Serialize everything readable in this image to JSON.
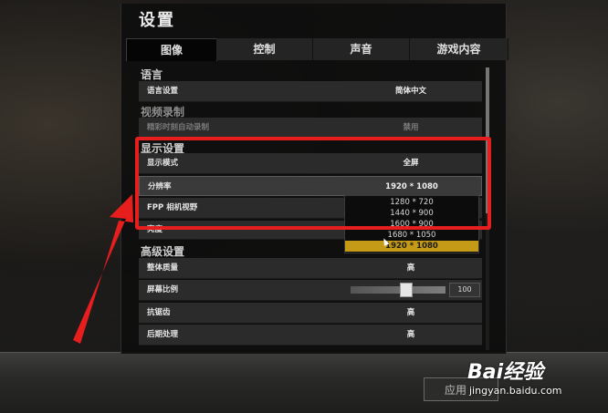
{
  "window": {
    "title": "设置"
  },
  "tabs": [
    {
      "label": "图像",
      "active": true
    },
    {
      "label": "控制",
      "active": false
    },
    {
      "label": "声音",
      "active": false
    },
    {
      "label": "游戏内容",
      "active": false
    }
  ],
  "sections": {
    "language": "语言",
    "video_recording": "视频录制",
    "display": "显示设置",
    "advanced": "高级设置"
  },
  "rows": {
    "language": {
      "label": "语言设置",
      "value": "简体中文"
    },
    "highlight": {
      "label": "精彩时刻自动录制",
      "value": "禁用"
    },
    "display_mode": {
      "label": "显示模式",
      "value": "全屏"
    },
    "resolution": {
      "label": "分辨率",
      "value": "1920 * 1080"
    },
    "fpp_fov": {
      "label": "FPP 相机视野",
      "value": ""
    },
    "brightness": {
      "label": "亮度",
      "value": ""
    },
    "overall_quality": {
      "label": "整体质量",
      "value": "高"
    },
    "screen_scale": {
      "label": "屏幕比例",
      "value": "100"
    },
    "anti_aliasing": {
      "label": "抗锯齿",
      "value": "高"
    },
    "post_processing": {
      "label": "后期处理",
      "value": "高"
    }
  },
  "resolution_dropdown": {
    "options": [
      "1280 * 720",
      "1440 * 900",
      "1600 * 900",
      "1680 * 1050",
      "1920 * 1080"
    ],
    "selected": "1920 * 1080"
  },
  "footer": {
    "apply_label": "应用"
  },
  "watermark": {
    "brand": "Bai经验",
    "url": "jingyan.baidu.com"
  },
  "colors": {
    "accent": "#c59a16",
    "annotation": "#e61e1e"
  }
}
